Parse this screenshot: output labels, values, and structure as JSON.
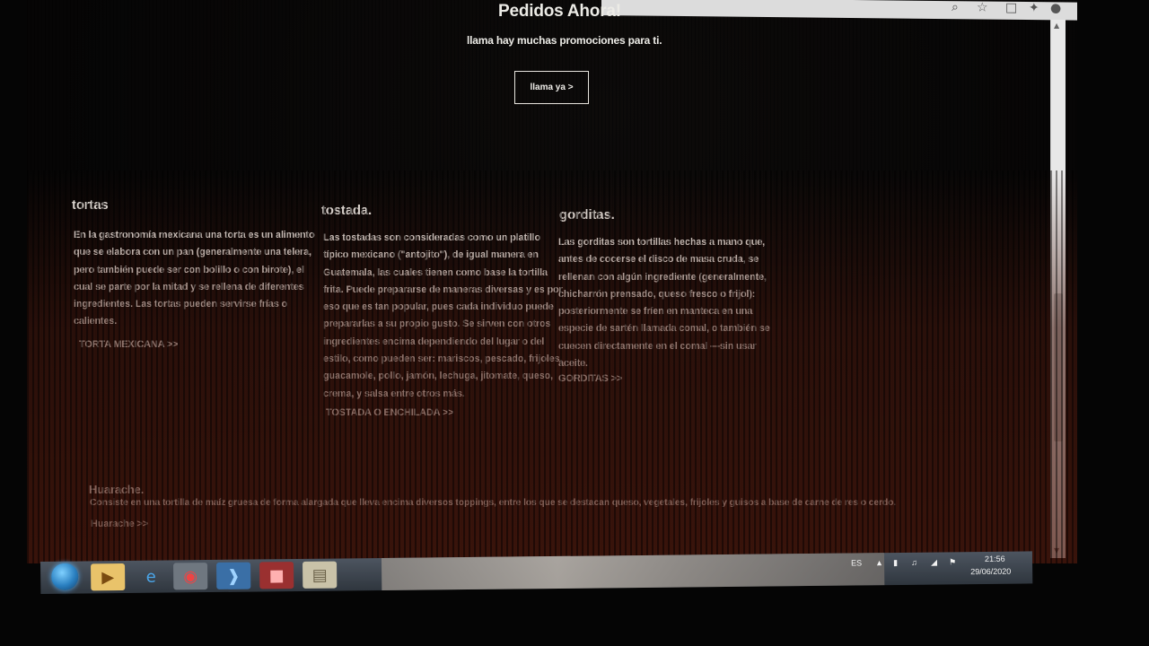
{
  "cta": {
    "title": "Pedidos Ahora!",
    "subtitle": "llama hay muchas promociones para ti.",
    "button_label": "llama ya >"
  },
  "columns": [
    {
      "title": "tortas",
      "body": "En la gastronomía mexicana una torta es un alimento que se elabora con un pan (generalmente una telera, pero también puede ser con bolillo o con birote), el cual se parte por la mitad y se rellena de diferentes ingredientes.  Las tortas pueden servirse frías o calientes.",
      "link": "TORTA MEXICANA >>"
    },
    {
      "title": "tostada.",
      "body": "Las tostadas son consideradas como un platillo típico mexicano (\"antojito\"), de igual manera en Guatemala, las cuales tienen como base la tortilla frita. Puede prepararse de maneras diversas y es por eso que es tan popular, pues cada individuo puede prepararlas a su propio gusto. Se sirven con otros ingredientes encima dependiendo del lugar o del estilo, como pueden ser: mariscos, pescado, frijoles, guacamole, pollo, jamón, lechuga, jitomate, queso, crema, y salsa entre otros más.",
      "link": "TOSTADA O ENCHILADA >>"
    },
    {
      "title": "gorditas.",
      "body": "Las gorditas son tortillas hechas a mano que, antes de cocerse el disco de masa cruda, se rellenan con algún ingrediente (generalmente, chicharrón prensado, queso fresco o frijol): posteriormente se fríen en manteca en una especie de sartén llamada comal, o también se cuecen directamente en el comal —sin usar aceite.",
      "link": "GORDITAS >>"
    }
  ],
  "huarache": {
    "title": "Huarache.",
    "body": "Consiste en una tortilla de maíz gruesa de forma alargada que lleva encima diversos toppings, entre los que se destacan queso, vegetales, frijoles y guisos a base de carne de res o cerdo.",
    "link": "Huarache >>"
  },
  "taskbar": {
    "language": "ES",
    "time": "21:56",
    "date": "29/06/2020",
    "apps": [
      "windows-explorer-icon",
      "internet-explorer-icon",
      "chrome-icon",
      "visual-studio-code-icon",
      "app-icon",
      "notepad-icon"
    ]
  },
  "browser": {
    "toolbar_icons": [
      "search-icon",
      "star-icon",
      "extension-icon",
      "puzzle-icon",
      "profile-icon",
      "menu-icon"
    ]
  }
}
